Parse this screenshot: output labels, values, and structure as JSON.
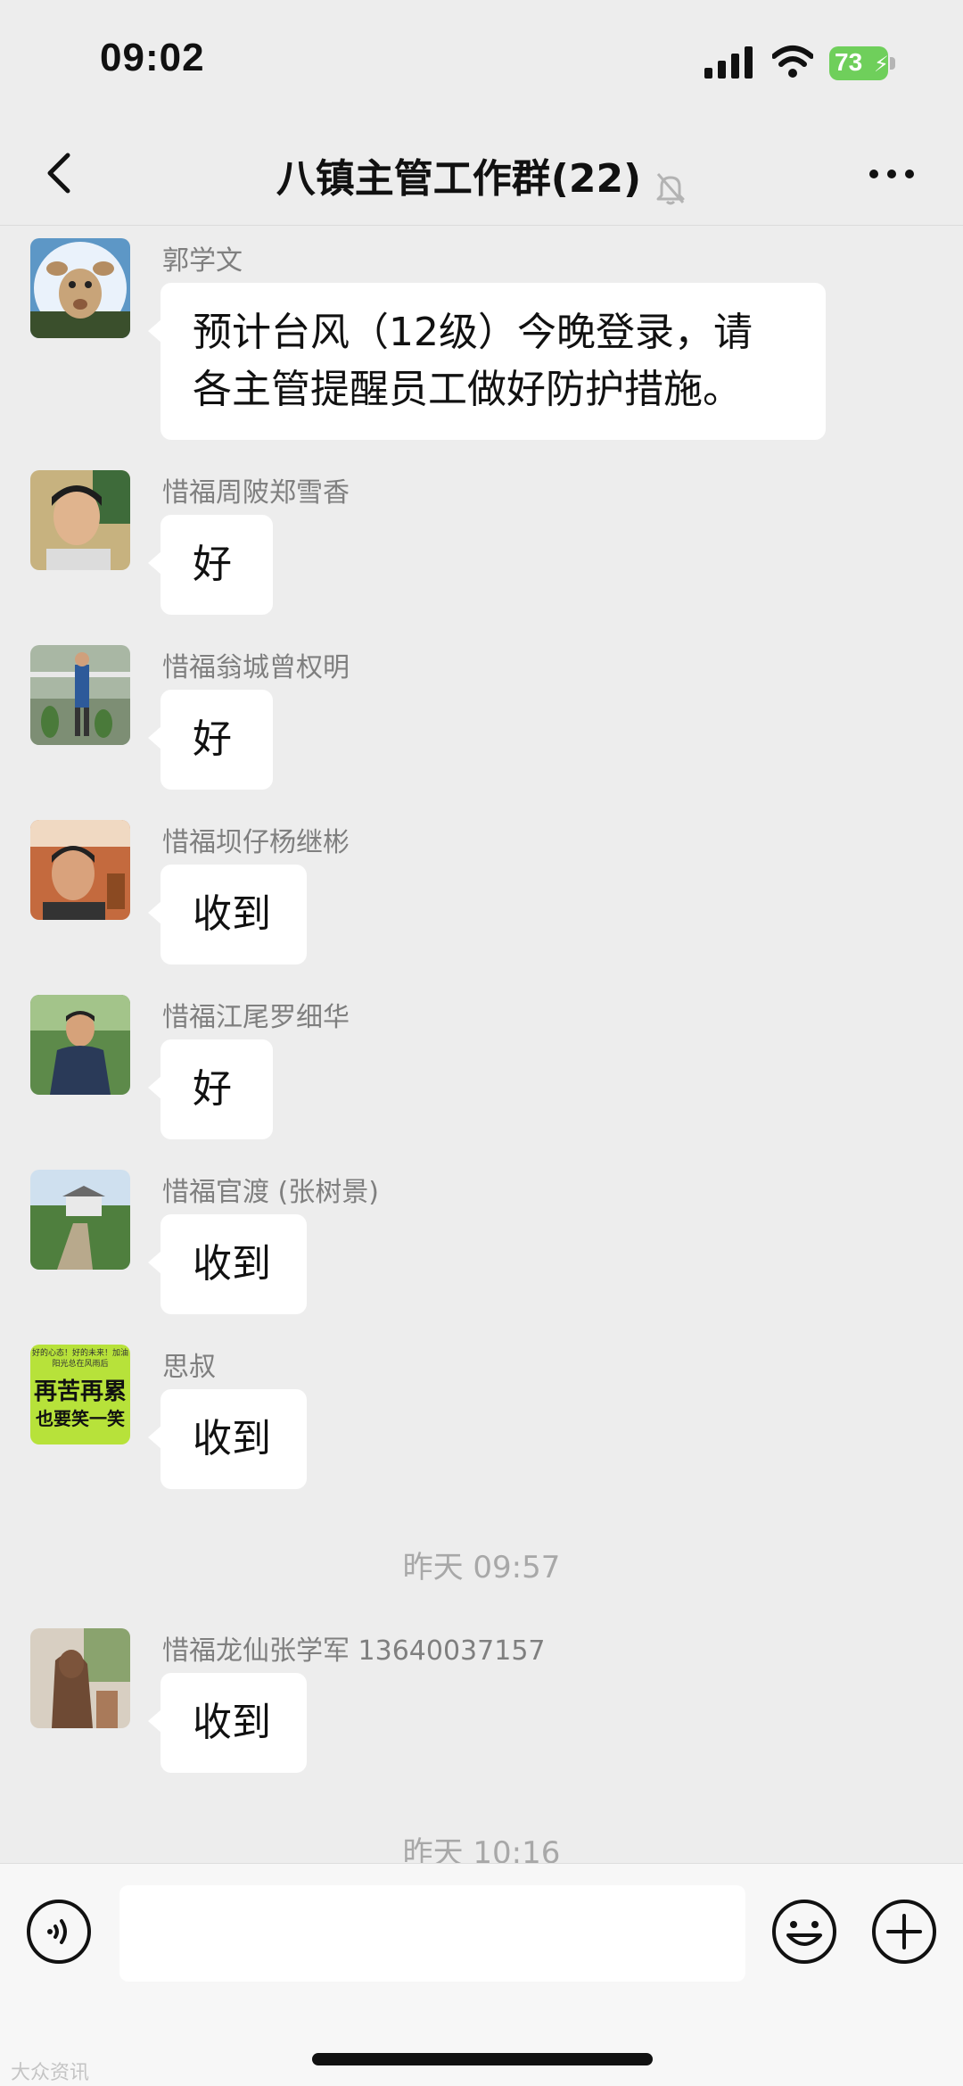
{
  "status_bar": {
    "time": "09:02",
    "battery": "73"
  },
  "nav": {
    "title": "八镇主管工作群(22)"
  },
  "messages": [
    {
      "sender": "郭学文",
      "text_line1": "预计台风（12级）今晚登录，请",
      "text_line2": "各主管提醒员工做好防护措施。"
    },
    {
      "sender": "惜福周陂郑雪香",
      "text": "好"
    },
    {
      "sender": "惜福翁城曾权明",
      "text": "好"
    },
    {
      "sender": "惜福坝仔杨继彬",
      "text": "收到"
    },
    {
      "sender": "惜福江尾罗细华",
      "text": "好"
    },
    {
      "sender": "惜福官渡 (张树景)",
      "text": "收到"
    },
    {
      "sender": "思叔",
      "text": "收到"
    },
    {
      "sender": "惜福龙仙张学军    13640037157",
      "text": "收到"
    }
  ],
  "avatar_text": {
    "line1": "好的心态！好的未来！加油",
    "line2": "阳光总在风雨后",
    "line3": "再苦再累",
    "line4": "也要笑一笑"
  },
  "timestamps": [
    "昨天 09:57",
    "昨天 10:16"
  ],
  "input": {
    "placeholder": ""
  },
  "watermark": "大众资讯",
  "colors": {
    "background": "#ededed",
    "bubble": "#ffffff",
    "battery": "#6fcf5b",
    "meta_text": "#7f7f7f"
  },
  "icons": {
    "back": "chevron-left-icon",
    "mute": "bell-off-icon",
    "more": "more-dots-icon",
    "voice": "voice-icon",
    "emoji": "emoji-icon",
    "plus": "plus-icon"
  }
}
